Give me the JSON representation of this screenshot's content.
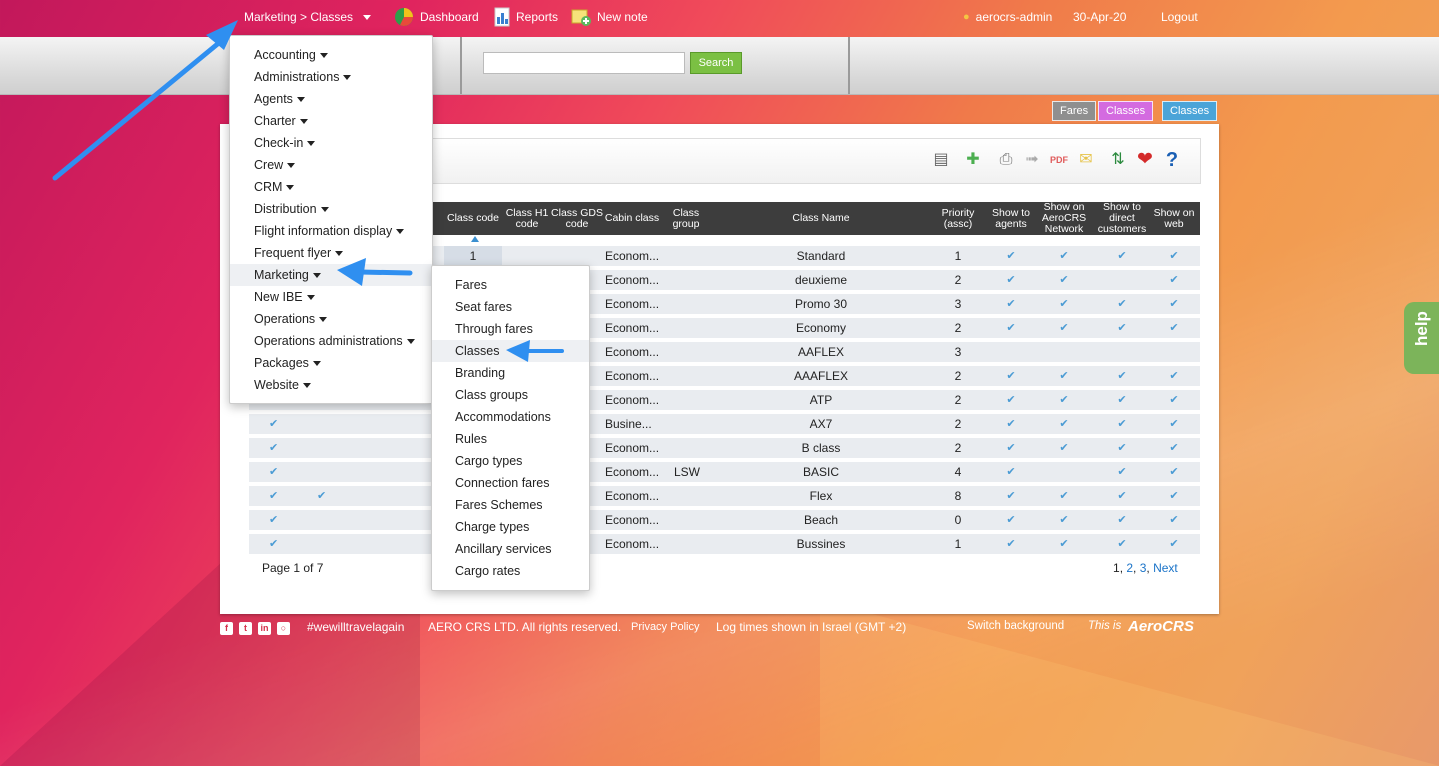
{
  "topbar": {
    "breadcrumb": "Marketing > Classes",
    "dashboard": "Dashboard",
    "reports": "Reports",
    "new_note": "New note",
    "user": "aerocrs-admin",
    "date": "30-Apr-20",
    "logout": "Logout"
  },
  "search": {
    "button": "Search",
    "value": ""
  },
  "tabs": [
    "Fares",
    "Classes",
    "Classes"
  ],
  "table": {
    "headers": [
      "Class code",
      "Class H1 code",
      "Class GDS code",
      "Cabin class",
      "Class group",
      "Class Name",
      "Priority (assc)",
      "Show to agents",
      "Show on AeroCRS Network",
      "Show to direct customers",
      "Show on web"
    ],
    "rows": [
      {
        "lead": "",
        "lead2": "",
        "code": "1",
        "cabin": "Econom...",
        "group": "",
        "name": "Standard",
        "priority": "1",
        "agents": "✔",
        "network": "✔",
        "direct": "✔",
        "web": "✔"
      },
      {
        "lead": "",
        "lead2": "",
        "code": "",
        "cabin": "Econom...",
        "group": "",
        "name": "deuxieme",
        "priority": "2",
        "agents": "✔",
        "network": "✔",
        "direct": "",
        "web": "✔"
      },
      {
        "lead": "",
        "lead2": "",
        "code": "",
        "cabin": "Econom...",
        "group": "",
        "name": "Promo 30",
        "priority": "3",
        "agents": "✔",
        "network": "✔",
        "direct": "✔",
        "web": "✔"
      },
      {
        "lead": "",
        "lead2": "",
        "code": "",
        "cabin": "Econom...",
        "group": "",
        "name": "Economy",
        "priority": "2",
        "agents": "✔",
        "network": "✔",
        "direct": "✔",
        "web": "✔"
      },
      {
        "lead": "",
        "lead2": "",
        "code": "",
        "cabin": "Econom...",
        "group": "",
        "name": "AAFLEX",
        "priority": "3",
        "agents": "",
        "network": "",
        "direct": "",
        "web": ""
      },
      {
        "lead": "",
        "lead2": "",
        "code": "",
        "cabin": "Econom...",
        "group": "",
        "name": "AAAFLEX",
        "priority": "2",
        "agents": "✔",
        "network": "✔",
        "direct": "✔",
        "web": "✔"
      },
      {
        "lead": "",
        "lead2": "",
        "code": "",
        "cabin": "Econom...",
        "group": "",
        "name": "ATP",
        "priority": "2",
        "agents": "✔",
        "network": "✔",
        "direct": "✔",
        "web": "✔"
      },
      {
        "lead": "✔",
        "lead2": "",
        "code": "",
        "cabin": "Busine...",
        "group": "",
        "name": "AX7",
        "priority": "2",
        "agents": "✔",
        "network": "✔",
        "direct": "✔",
        "web": "✔"
      },
      {
        "lead": "✔",
        "lead2": "",
        "code": "",
        "cabin": "Econom...",
        "group": "",
        "name": "B class",
        "priority": "2",
        "agents": "✔",
        "network": "✔",
        "direct": "✔",
        "web": "✔"
      },
      {
        "lead": "✔",
        "lead2": "",
        "code": "",
        "cabin": "Econom...",
        "group": "LSW",
        "name": "BASIC",
        "priority": "4",
        "agents": "✔",
        "network": "",
        "direct": "✔",
        "web": "✔"
      },
      {
        "lead": "✔",
        "lead2": "✔",
        "code": "",
        "cabin": "Econom...",
        "group": "",
        "name": "Flex",
        "priority": "8",
        "agents": "✔",
        "network": "✔",
        "direct": "✔",
        "web": "✔"
      },
      {
        "lead": "✔",
        "lead2": "",
        "code": "",
        "cabin": "Econom...",
        "group": "",
        "name": "Beach",
        "priority": "0",
        "agents": "✔",
        "network": "✔",
        "direct": "✔",
        "web": "✔"
      },
      {
        "lead": "✔",
        "lead2": "",
        "code": "",
        "cabin": "Econom...",
        "group": "",
        "name": "Bussines",
        "priority": "1",
        "agents": "✔",
        "network": "✔",
        "direct": "✔",
        "web": "✔"
      }
    ]
  },
  "pager": {
    "left": "Page 1 of 7",
    "p1": "1",
    "p2": "2",
    "p3": "3",
    "next": "Next"
  },
  "main_menu": [
    "Accounting",
    "Administrations",
    "Agents",
    "Charter",
    "Check-in",
    "Crew",
    "CRM",
    "Distribution",
    "Flight information display",
    "Frequent flyer",
    "Marketing",
    "New IBE",
    "Operations",
    "Operations administrations",
    "Packages",
    "Website"
  ],
  "sub_menu": [
    "Fares",
    "Seat fares",
    "Through fares",
    "Classes",
    "Branding",
    "Class groups",
    "Accommodations",
    "Rules",
    "Cargo types",
    "Connection fares",
    "Fares Schemes",
    "Charge types",
    "Ancillary services",
    "Cargo rates"
  ],
  "footer": {
    "hashtag": "#wewilltravelagain",
    "copyright": "AERO CRS LTD. All rights reserved.",
    "privacy": "Privacy Policy",
    "log_times": "Log times shown in Israel (GMT +2)",
    "switch_bg": "Switch background",
    "this_is": "This is",
    "brand": "AeroCRS"
  },
  "help": "help",
  "colors": {
    "annotation_arrow": "#2f8ff0",
    "check": "#4a9bd4",
    "search_button": "#7bc043"
  }
}
